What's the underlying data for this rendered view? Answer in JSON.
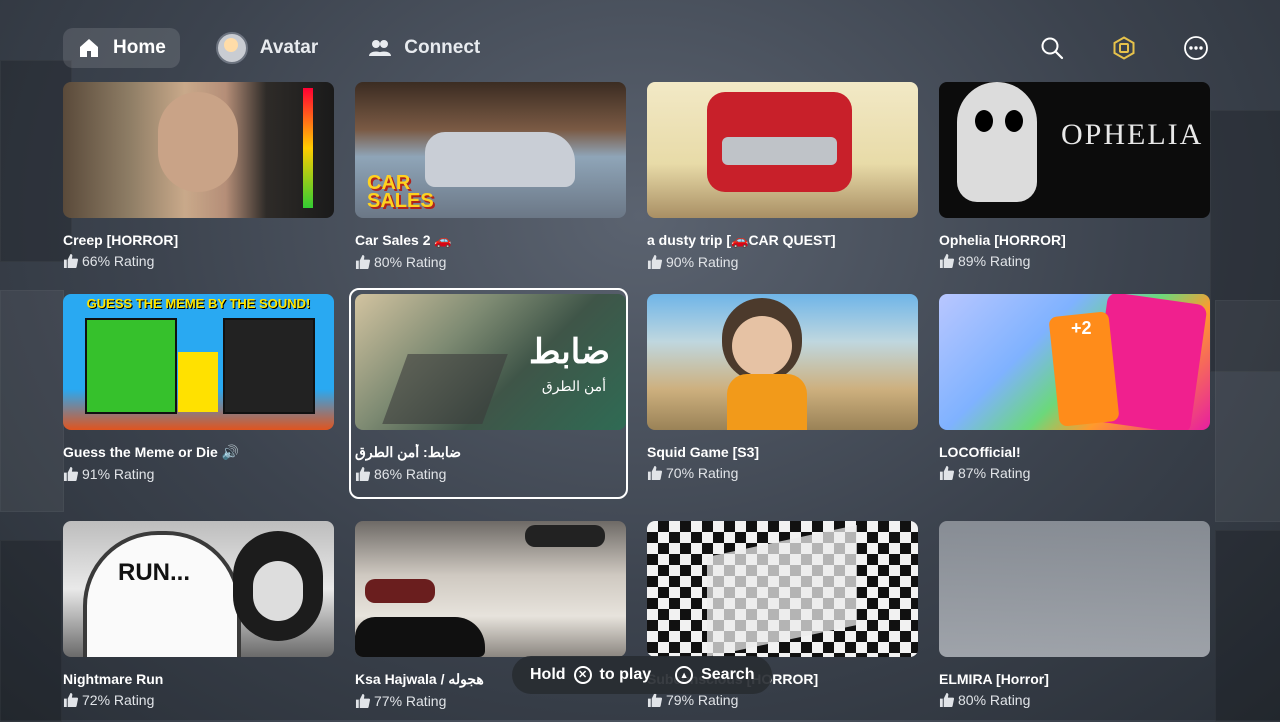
{
  "nav": {
    "items": [
      {
        "label": "Home",
        "icon": "home-icon",
        "active": true
      },
      {
        "label": "Avatar",
        "icon": "avatar-icon",
        "active": false
      },
      {
        "label": "Connect",
        "icon": "people-icon",
        "active": false
      }
    ],
    "right_icons": [
      "search-icon",
      "robux-icon",
      "more-icon"
    ]
  },
  "accent": "#ffffff",
  "games": [
    {
      "title": "Creep [HORROR]",
      "rating": "66% Rating"
    },
    {
      "title": "Car Sales 2 🚗",
      "rating": "80% Rating",
      "thumb_text": "CAR SALES"
    },
    {
      "title": "a dusty trip [🚗CAR QUEST]",
      "rating": "90% Rating"
    },
    {
      "title": "Ophelia [HORROR]",
      "rating": "89% Rating",
      "thumb_text": "OPHELIA"
    },
    {
      "title": "Guess the Meme or Die 🔊",
      "rating": "91% Rating",
      "thumb_text": "GUESS THE MEME BY THE SOUND!"
    },
    {
      "title": "ضابط: أمن الطرق",
      "rating": "86% Rating",
      "thumb_text": "ضابط",
      "thumb_subtext": "أمن الطرق",
      "focused": true
    },
    {
      "title": "Squid Game [S3]",
      "rating": "70% Rating"
    },
    {
      "title": "LOCOfficial!",
      "rating": "87% Rating",
      "thumb_text": "+2"
    },
    {
      "title": "Nightmare Run",
      "rating": "72% Rating",
      "thumb_text": "RUN..."
    },
    {
      "title": "Ksa Hajwala / هجوله",
      "rating": "77% Rating"
    },
    {
      "title": "Subconscious [HORROR]",
      "rating": "79% Rating"
    },
    {
      "title": "ELMIRA [Horror]",
      "rating": "80% Rating"
    }
  ],
  "hint": {
    "hold": "Hold",
    "to_play": "to play",
    "search": "Search"
  }
}
